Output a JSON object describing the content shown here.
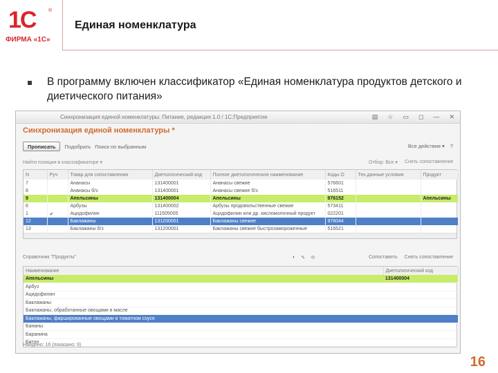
{
  "logo": {
    "mark": "1С",
    "reg": "®",
    "firm": "ФИРМА «1С»"
  },
  "slide": {
    "title": "Единая номенклатура",
    "bullet": "В программу включен классификатор «Единая номенклатура продуктов детского и диетического питания»",
    "page_number": "16"
  },
  "window": {
    "title": "Синхронизация единой номенклатуры: Питание, редакция 1.0 / 1С:Предприятие",
    "controls": [
      "▤",
      "☆",
      "▭",
      "◻",
      "—",
      "✕"
    ],
    "form_title": "Синхронизация единой номенклатуры *",
    "toolbar": {
      "primary": "Прописать",
      "secondary": "Подобрать",
      "link": "Поиск по выбранным"
    },
    "right_tools": [
      "Все действия ▾",
      "?"
    ],
    "filter_left": "Найти позиции в классификаторе ▾",
    "filter_right1": "Отбор: Все ▾",
    "filter_right2": "Снять сопоставление"
  },
  "grid": {
    "headers": [
      "N",
      "Руч",
      "Товар для сопоставления",
      "Диетологический код",
      "Полное диетологическое наименование",
      "Коды О",
      "Тех.данные условия",
      "Продукт"
    ],
    "rows": [
      {
        "cells": [
          "7",
          "",
          "Ананасы",
          "131400001",
          "Ананасы свежие",
          "576601",
          "",
          ""
        ],
        "state": "normal"
      },
      {
        "cells": [
          "8",
          "",
          "Ананасы б/з",
          "131400001",
          "Ананасы свежие б/з",
          "516511",
          "",
          ""
        ],
        "state": "normal"
      },
      {
        "cells": [
          "9",
          "",
          "Апельсины",
          "131400004",
          "Апельсины",
          "976152",
          "",
          "Апельсины"
        ],
        "state": "hl"
      },
      {
        "cells": [
          "6",
          "",
          "Арбузы",
          "131400002",
          "Арбузы продовольственные свежие",
          "573411",
          "",
          ""
        ],
        "state": "normal"
      },
      {
        "cells": [
          "1",
          "✔",
          "Ацидофилин",
          "111505005",
          "Ацидофилин или др. кисломолочный продукт",
          "022201",
          "",
          ""
        ],
        "state": "normal"
      },
      {
        "cells": [
          "12",
          "",
          "Баклажаны",
          "131200001",
          "Баклажаны свежие",
          "976044",
          "",
          ""
        ],
        "state": "sel"
      },
      {
        "cells": [
          "13",
          "",
          "Баклажаны б/з",
          "131200001",
          "Баклажаны свежие быстрозамороженные",
          "516521",
          "",
          ""
        ],
        "state": "normal"
      }
    ]
  },
  "grid2": {
    "toolbar_left": "Справочник \"Продукты\"",
    "toolbar_mid": [
      "◐",
      "✎",
      "⟲"
    ],
    "toolbar_right": [
      "Сопоставить",
      "Снять сопоставление"
    ],
    "headers": [
      "Наименование",
      "Диетологический код"
    ],
    "rows": [
      {
        "cells": [
          "Апельсины",
          "131400004"
        ],
        "state": "hl"
      },
      {
        "cells": [
          "Арбуз",
          ""
        ],
        "state": "normal"
      },
      {
        "cells": [
          "Ацидофилин",
          ""
        ],
        "state": "normal"
      },
      {
        "cells": [
          "Баклажаны",
          ""
        ],
        "state": "normal"
      },
      {
        "cells": [
          "Баклажаны, обработанные овощами в масле",
          ""
        ],
        "state": "normal"
      },
      {
        "cells": [
          "Баклажаны, фаршированные овощами в томатном соусе",
          ""
        ],
        "state": "sel"
      },
      {
        "cells": [
          "Бананы",
          ""
        ],
        "state": "normal"
      },
      {
        "cells": [
          "Баранина",
          ""
        ],
        "state": "normal"
      },
      {
        "cells": [
          "Батон",
          ""
        ],
        "state": "normal"
      }
    ],
    "found_label": "Найдено: 16 (показано: 9)"
  }
}
